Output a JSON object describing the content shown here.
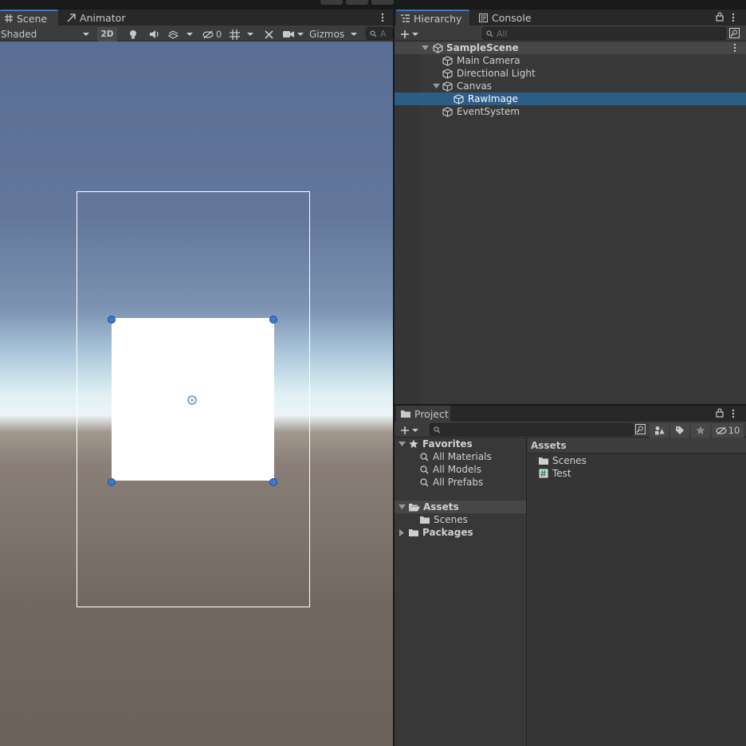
{
  "scene": {
    "tabs": [
      {
        "label": "Scene",
        "icon": "grid-icon"
      },
      {
        "label": "Animator",
        "icon": "animator-icon"
      }
    ],
    "shading_mode": "Shaded",
    "toggle_2d": "2D",
    "hidden_count": "0",
    "gizmos_label": "Gizmos",
    "search_placeholder": "A",
    "image_fill_color": "#ffffff",
    "handle_color": "#3a7ad0",
    "canvas_outline_color": "#ffffff"
  },
  "hierarchy": {
    "tabs": [
      {
        "label": "Hierarchy",
        "icon": "hierarchy-icon"
      },
      {
        "label": "Console",
        "icon": "console-icon"
      }
    ],
    "search_placeholder": "All",
    "scene_name": "SampleScene",
    "items": [
      {
        "label": "Main Camera",
        "depth": 1,
        "expanded": null,
        "selected": false
      },
      {
        "label": "Directional Light",
        "depth": 1,
        "expanded": null,
        "selected": false
      },
      {
        "label": "Canvas",
        "depth": 1,
        "expanded": true,
        "selected": false
      },
      {
        "label": "RawImage",
        "depth": 2,
        "expanded": null,
        "selected": true
      },
      {
        "label": "EventSystem",
        "depth": 1,
        "expanded": null,
        "selected": false
      }
    ],
    "selection_color": "#2c5d87"
  },
  "project": {
    "tab_label": "Project",
    "hidden_packages_count": "10",
    "sidebar": {
      "favorites_label": "Favorites",
      "favorites": [
        "All Materials",
        "All Models",
        "All Prefabs"
      ],
      "assets_label": "Assets",
      "assets_children": [
        "Scenes"
      ],
      "packages_label": "Packages"
    },
    "breadcrumb": "Assets",
    "files": [
      {
        "label": "Scenes",
        "icon": "folder-icon"
      },
      {
        "label": "Test",
        "icon": "csharp-script-icon"
      }
    ]
  }
}
